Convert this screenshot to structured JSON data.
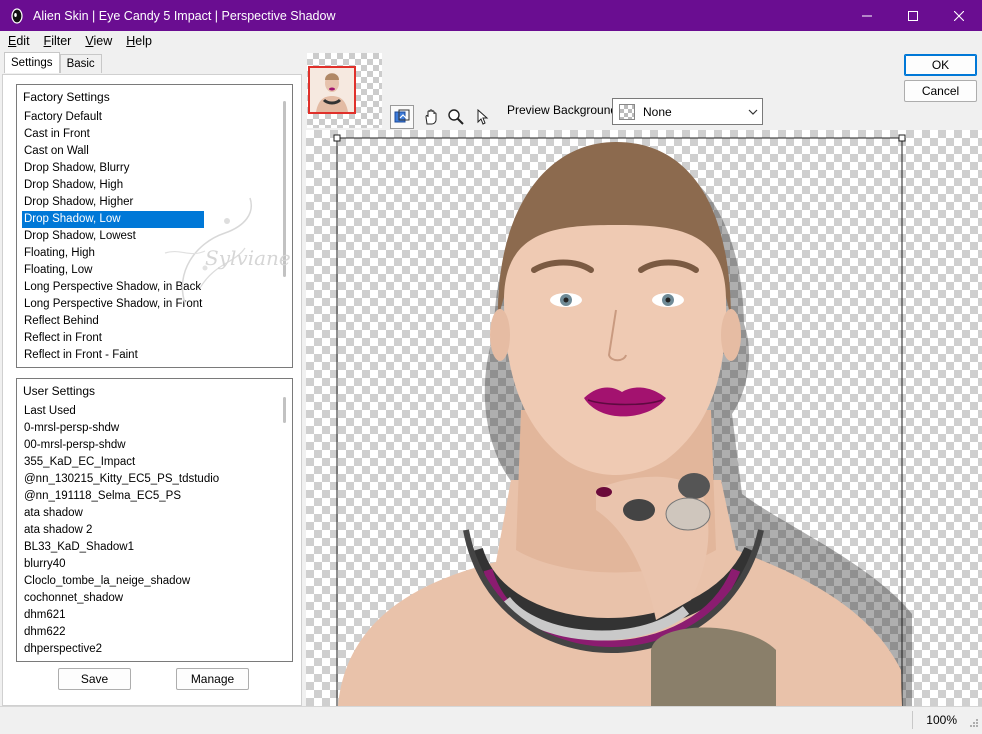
{
  "window": {
    "title": "Alien Skin | Eye Candy 5 Impact | Perspective Shadow",
    "accent_color": "#6a0d91"
  },
  "menu": [
    {
      "label": "Edit",
      "mnemonic": "E",
      "rest": "dit"
    },
    {
      "label": "Filter",
      "mnemonic": "F",
      "rest": "ilter"
    },
    {
      "label": "View",
      "mnemonic": "V",
      "rest": "iew"
    },
    {
      "label": "Help",
      "mnemonic": "H",
      "rest": "elp"
    }
  ],
  "tabs": {
    "settings": "Settings",
    "basic": "Basic"
  },
  "factory_settings": {
    "header": "Factory Settings",
    "selected": "Drop Shadow, Low",
    "items": [
      "Factory Default",
      "Cast in Front",
      "Cast on Wall",
      "Drop Shadow, Blurry",
      "Drop Shadow, High",
      "Drop Shadow, Higher",
      "Drop Shadow, Low",
      "Drop Shadow, Lowest",
      "Floating, High",
      "Floating, Low",
      "Long Perspective Shadow, in Back",
      "Long Perspective Shadow, in Front",
      "Reflect Behind",
      "Reflect in Front",
      "Reflect in Front - Faint"
    ]
  },
  "user_settings": {
    "header": "User Settings",
    "items": [
      "Last Used",
      "0-mrsl-persp-shdw",
      "00-mrsl-persp-shdw",
      "355_KaD_EC_Impact",
      "@nn_130215_Kitty_EC5_PS_tdstudio",
      "@nn_191118_Selma_EC5_PS",
      "ata shadow",
      "ata shadow 2",
      "BL33_KaD_Shadow1",
      "blurry40",
      "Cloclo_tombe_la_neige_shadow",
      "cochonnet_shadow",
      "dhm621",
      "dhm622",
      "dhperspective2"
    ]
  },
  "buttons": {
    "save": "Save",
    "manage": "Manage",
    "ok": "OK",
    "cancel": "Cancel"
  },
  "preview": {
    "background_label": "Preview Background:",
    "background_value": "None",
    "watermark_text": "Sylviane"
  },
  "status": {
    "zoom": "100%"
  },
  "icons": [
    "app-icon",
    "minimize-icon",
    "maximize-icon",
    "close-icon",
    "preview-toggle-icon",
    "hand-icon",
    "zoom-icon",
    "pointer-icon",
    "chevron-down-icon",
    "resize-grip-icon"
  ]
}
